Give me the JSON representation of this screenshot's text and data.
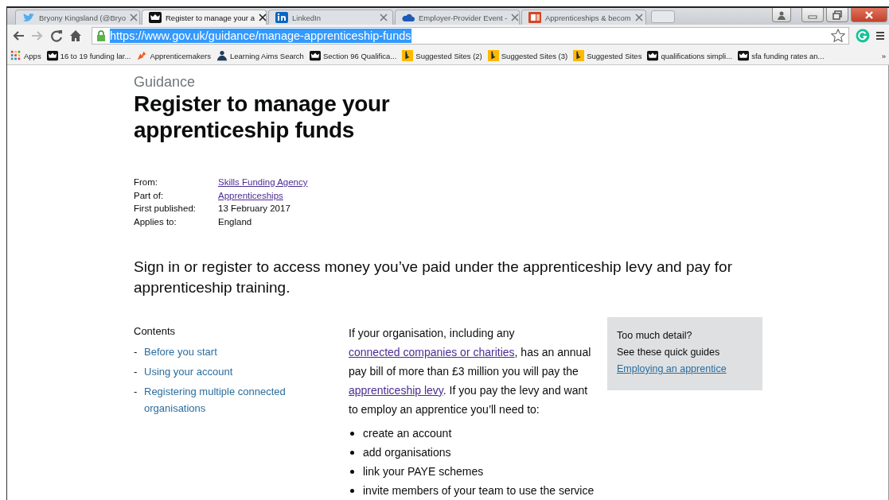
{
  "tabs": [
    {
      "title": "Bryony Kingsland (@Bryo",
      "kind": "bird",
      "selected": false
    },
    {
      "title": "Register to manage your a",
      "kind": "crown",
      "selected": true
    },
    {
      "title": "LinkedIn",
      "kind": "in",
      "selected": false
    },
    {
      "title": "Employer-Provider Event -",
      "kind": "cloud",
      "selected": false
    },
    {
      "title": "Apprenticeships & becom",
      "kind": "slides",
      "selected": false
    }
  ],
  "address_bar": {
    "url": "https://www.gov.uk/guidance/manage-apprenticeship-funds",
    "selected": true
  },
  "bookmarks": [
    {
      "label": "Apps",
      "kind": "grid"
    },
    {
      "label": "16 to 19 funding lar...",
      "kind": "crown"
    },
    {
      "label": "Apprenticemakers",
      "kind": "flame"
    },
    {
      "label": "Learning Aims Search",
      "kind": "person"
    },
    {
      "label": "Section 96  Qualifica...",
      "kind": "crown"
    },
    {
      "label": "Suggested Sites (2)",
      "kind": "bing"
    },
    {
      "label": "Suggested Sites (3)",
      "kind": "bing"
    },
    {
      "label": "Suggested Sites",
      "kind": "bing"
    },
    {
      "label": "qualifications simpli...",
      "kind": "crown"
    },
    {
      "label": "sfa funding rates an...",
      "kind": "crown"
    }
  ],
  "bookmarks_overflow": "»",
  "page": {
    "section": "Guidance",
    "title": "Register to manage your apprenticeship funds",
    "metadata": [
      {
        "label": "From:",
        "value": "Skills Funding Agency",
        "link": true
      },
      {
        "label": "Part of:",
        "value": "Apprenticeships",
        "link": true
      },
      {
        "label": "First published:",
        "value": "13 February 2017",
        "link": false
      },
      {
        "label": "Applies to:",
        "value": "England",
        "link": false
      }
    ],
    "lead": "Sign in or register to access money you’ve paid under the apprenticeship levy and pay for apprenticeship training.",
    "contents": {
      "heading": "Contents",
      "items": [
        {
          "dash": "-",
          "label": "Before you start"
        },
        {
          "dash": "-",
          "label": "Using your account"
        },
        {
          "dash": "-",
          "label": "Registering multiple connected organisations"
        }
      ]
    },
    "intro": [
      {
        "kind": "text",
        "text": "If your organisation, including any "
      },
      {
        "kind": "link",
        "text": "connected companies or charities"
      },
      {
        "kind": "text",
        "text": ", has an annual pay bill of more than £3 million you will pay the "
      },
      {
        "kind": "link",
        "text": "apprenticeship levy"
      },
      {
        "kind": "text",
        "text": ". If you pay the levy and want to employ an apprentice you’ll need to:"
      }
    ],
    "steps": [
      "create an account",
      "add organisations",
      "link your PAYE schemes",
      "invite members of your team to use the service"
    ],
    "aside": {
      "question": "Too much detail?",
      "prompt": "See these quick guides",
      "link": "Employing an apprentice"
    }
  }
}
